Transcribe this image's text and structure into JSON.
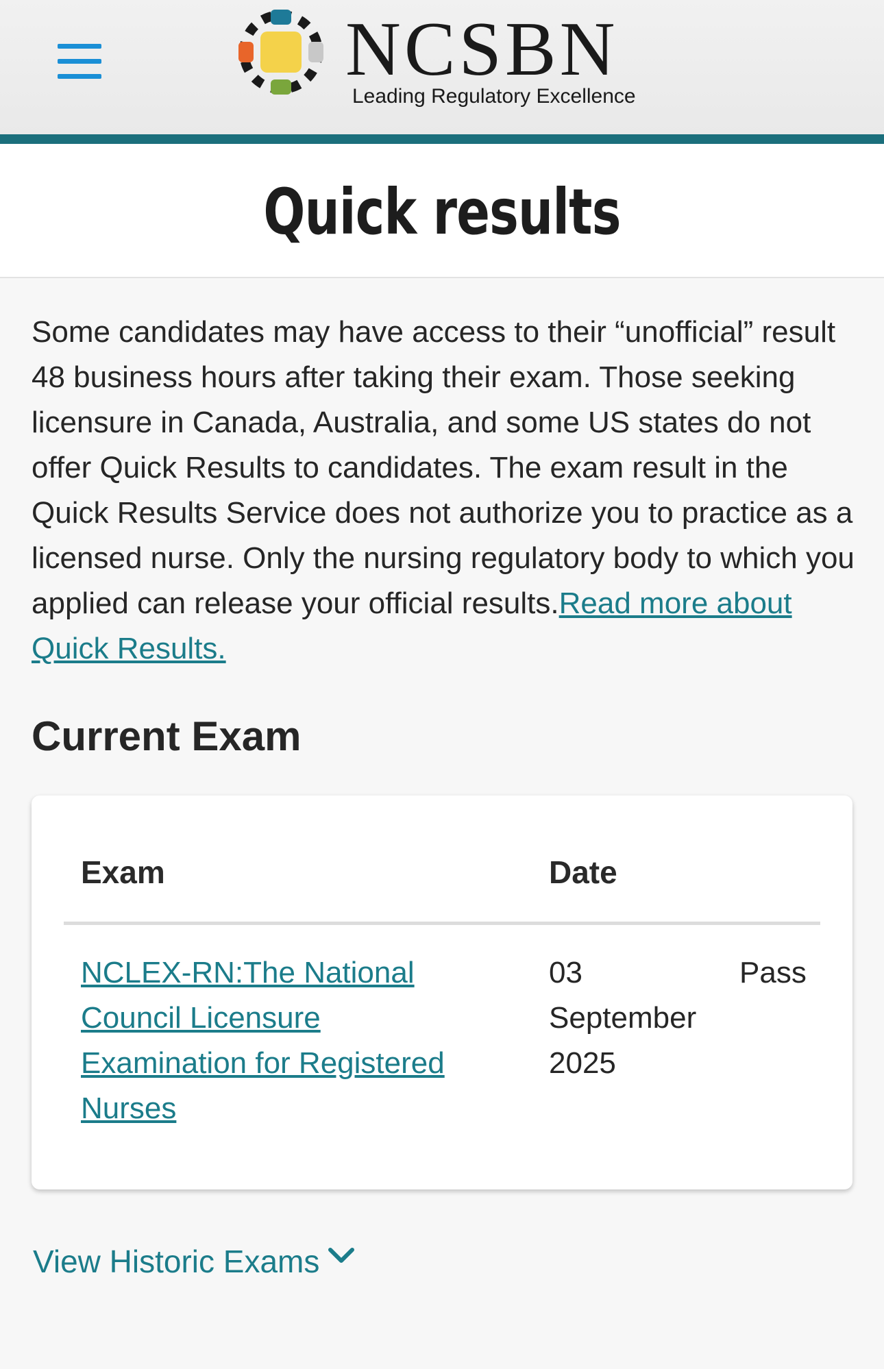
{
  "header": {
    "logo_word": "NCSBN",
    "logo_tagline": "Leading Regulatory Excellence",
    "menu_icon": "hamburger-menu-icon",
    "accent_color": "#1b6f7c",
    "menu_color": "#1a8fd6"
  },
  "page": {
    "title": "Quick results"
  },
  "intro": {
    "text": "Some candidates may have access to their “unofficial” result 48 business hours after taking their exam. Those seeking licensure in Canada, Australia, and some US states do not offer Quick Results to candidates.  The exam result in the Quick Results Service does not authorize you to practice as a licensed nurse. Only the nursing regulatory body to which you applied can release your official results.",
    "link_text": "Read more about Quick Results."
  },
  "current_exam": {
    "heading": "Current Exam",
    "columns": [
      "Exam",
      "Date"
    ],
    "rows": [
      {
        "exam": "NCLEX-RN:The National Council Licensure Examination for Registered Nurses",
        "date": "03 September 2025",
        "result": "Pass"
      }
    ]
  },
  "historic": {
    "label": "View Historic Exams",
    "icon": "chevron-down-icon"
  },
  "colors": {
    "link": "#1b7c8a",
    "text": "#262626",
    "background": "#f7f7f7"
  }
}
